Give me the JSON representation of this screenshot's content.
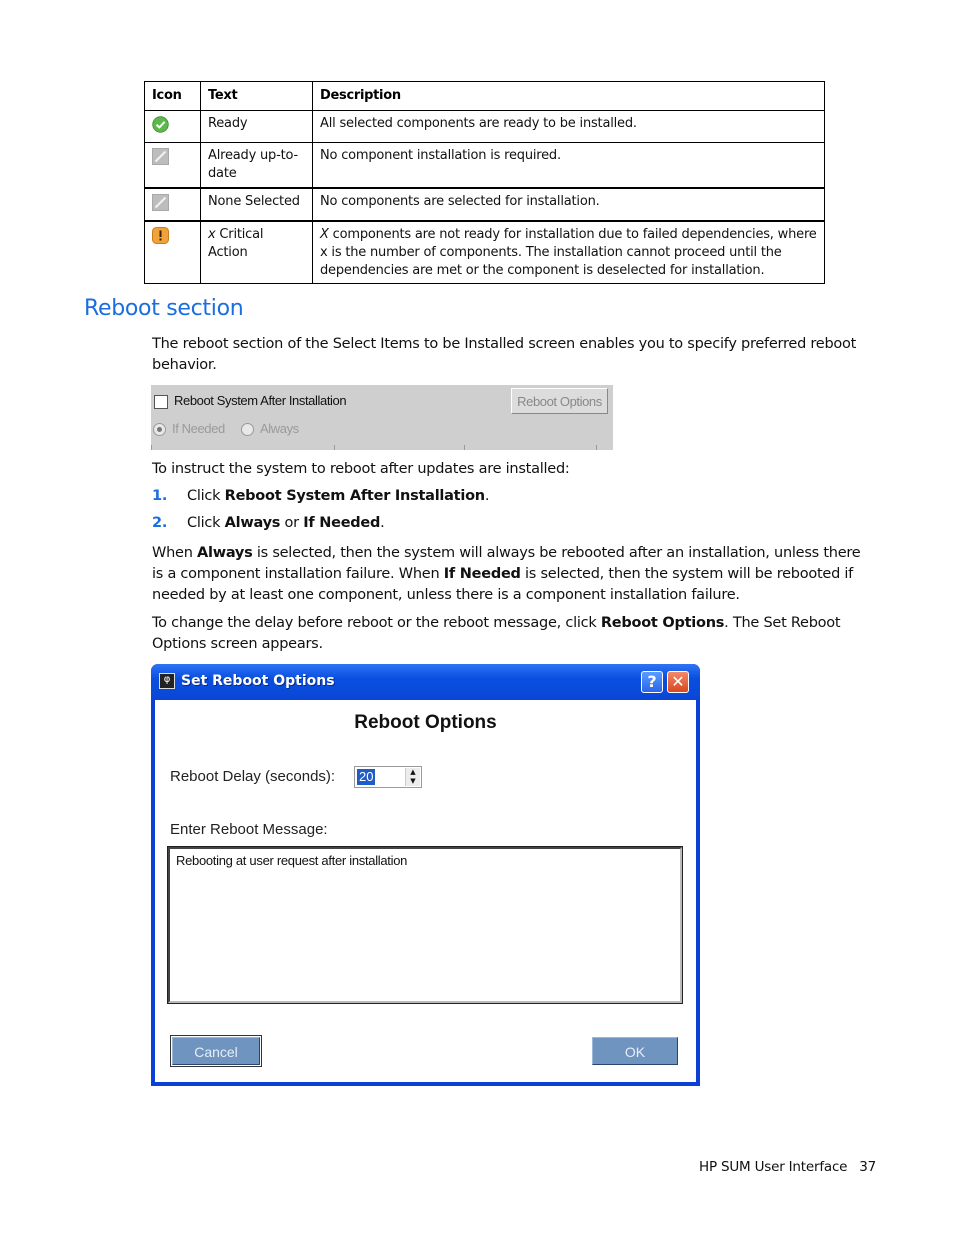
{
  "table": {
    "headers": [
      "Icon",
      "Text",
      "Description"
    ],
    "rows": [
      {
        "icon": "green-check-icon",
        "text": "Ready",
        "description": "All selected components are ready to be installed."
      },
      {
        "icon": "gray-slash-icon",
        "text": "Already up-to-date",
        "description": "No component installation is required."
      },
      {
        "icon": "gray-slash-icon",
        "text": "None Selected",
        "description": "No components are selected for installation."
      },
      {
        "icon": "orange-warning-icon",
        "text_italic": "x",
        "text": " Critical Action",
        "description_italic": "X",
        "description": " components are not ready for installation due to failed dependencies, where x is the number of components. The installation cannot proceed until the dependencies are met or the component is deselected for installation."
      }
    ]
  },
  "section": {
    "title": "Reboot section",
    "intro": "The reboot section of the Select Items to be Installed screen enables you to specify preferred reboot behavior."
  },
  "panel": {
    "checkbox_label": "Reboot System After Installation",
    "checkbox_checked": false,
    "radio_if_needed": "If Needed",
    "radio_always": "Always",
    "selected_radio": "If Needed",
    "options_button": "Reboot Options"
  },
  "instructions": {
    "lead": "To instruct the system to reboot after updates are installed:",
    "steps": [
      {
        "num": "1.",
        "pre": "Click ",
        "bold": "Reboot System After Installation",
        "post": "."
      },
      {
        "num": "2.",
        "pre": "Click ",
        "bold": "Always",
        "mid": " or ",
        "bold2": "If Needed",
        "post": "."
      }
    ],
    "para1": {
      "a": "When ",
      "b1": "Always",
      "c": " is selected, then the system will always be rebooted after an installation, unless there is a component installation failure. When ",
      "b2": "If Needed",
      "d": " is selected, then the system will be rebooted if needed by at least one component, unless there is a component installation failure."
    },
    "para2": {
      "a": "To change the delay before reboot or the reboot message, click ",
      "b": "Reboot Options",
      "c": ". The Set Reboot Options screen appears."
    }
  },
  "dialog": {
    "title": "Set Reboot Options",
    "help_glyph": "?",
    "close_glyph": "✕",
    "heading": "Reboot Options",
    "delay_label": "Reboot Delay (seconds):",
    "delay_value": "20",
    "message_label": "Enter Reboot Message:",
    "message_value": "Rebooting at user request after installation",
    "cancel_label": "Cancel",
    "ok_label": "OK"
  },
  "footer": {
    "title": "HP SUM User Interface",
    "page": "37"
  },
  "colors": {
    "heading_blue": "#1a6ee0",
    "title_bar": "#0a4fe0",
    "button_blue": "#6e94bf"
  }
}
